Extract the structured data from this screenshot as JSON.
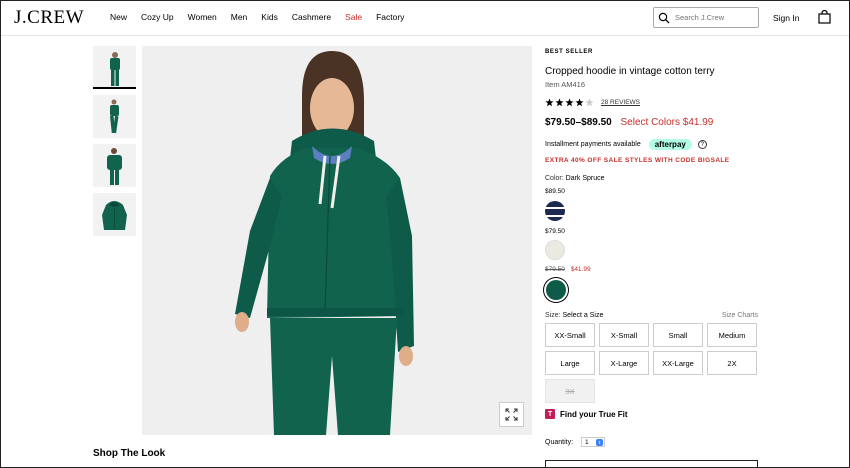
{
  "header": {
    "logo": "J.CREW",
    "nav": [
      "New",
      "Cozy Up",
      "Women",
      "Men",
      "Kids",
      "Cashmere",
      "Sale",
      "Factory"
    ],
    "search_placeholder": "Search J.Crew",
    "sign_in": "Sign In"
  },
  "gallery": {
    "shop_the_look": "Shop The Look"
  },
  "product": {
    "badge": "BEST SELLER",
    "title": "Cropped hoodie in vintage cotton terry",
    "item": "Item AM416",
    "rating": 4,
    "reviews": "28 REVIEWS",
    "price_range": "$79.50–$89.50",
    "select_colors": "Select Colors",
    "sale_price": "$41.99",
    "installment": "Installment payments available",
    "afterpay": "afterpay",
    "promo": "EXTRA 40% OFF SALE STYLES WITH CODE BIGSALE",
    "color_label": "Color:",
    "color_value": "Dark Spruce",
    "swatch_groups": [
      {
        "price": "$89.50",
        "color": "#1c2a4f"
      },
      {
        "price": "$79.50",
        "color": "#ece9e2"
      },
      {
        "orig": "$79.50",
        "sale": "$41.99",
        "color": "#0f5b4a"
      }
    ],
    "size_label": "Size:",
    "size_value": "Select a Size",
    "size_charts": "Size Charts",
    "sizes": [
      "XX-Small",
      "X-Small",
      "Small",
      "Medium",
      "Large",
      "X-Large",
      "XX-Large",
      "2X",
      "3X"
    ],
    "true_fit": "Find your True Fit",
    "true_fit_logo": "T",
    "quantity_label": "Quantity:",
    "quantity": "1"
  },
  "colors": {
    "accent_red": "#c4302b",
    "afterpay_mint": "#b2fce4",
    "garment_green": "#11634e"
  }
}
